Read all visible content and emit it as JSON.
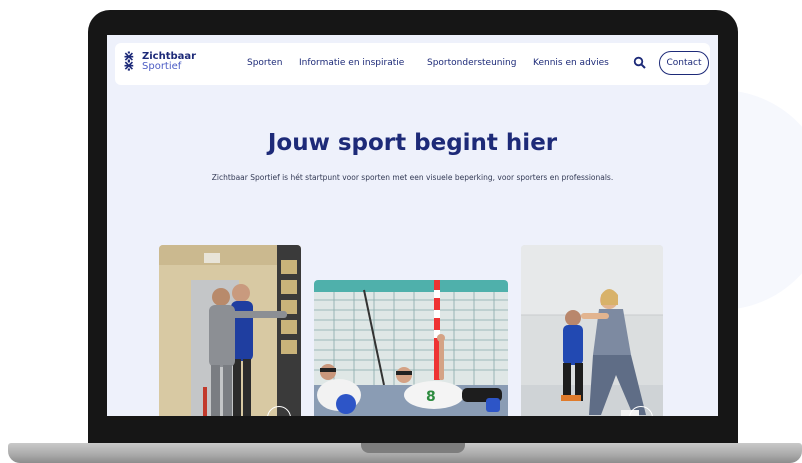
{
  "nav": {
    "logo_line1": "Zichtbaar",
    "logo_line2": "Sportief",
    "items": [
      "Sporten",
      "Informatie en inspiratie",
      "Sportondersteuning",
      "Kennis en advies"
    ],
    "contact_label": "Contact"
  },
  "hero": {
    "title": "Jouw sport begint hier",
    "subtitle": "Zichtbaar Sportief is hét startpunt voor sporten met een visuele beperking, voor sporters en professionals."
  },
  "colors": {
    "brand_navy": "#1d2a78",
    "page_bg": "#eef1fb"
  }
}
